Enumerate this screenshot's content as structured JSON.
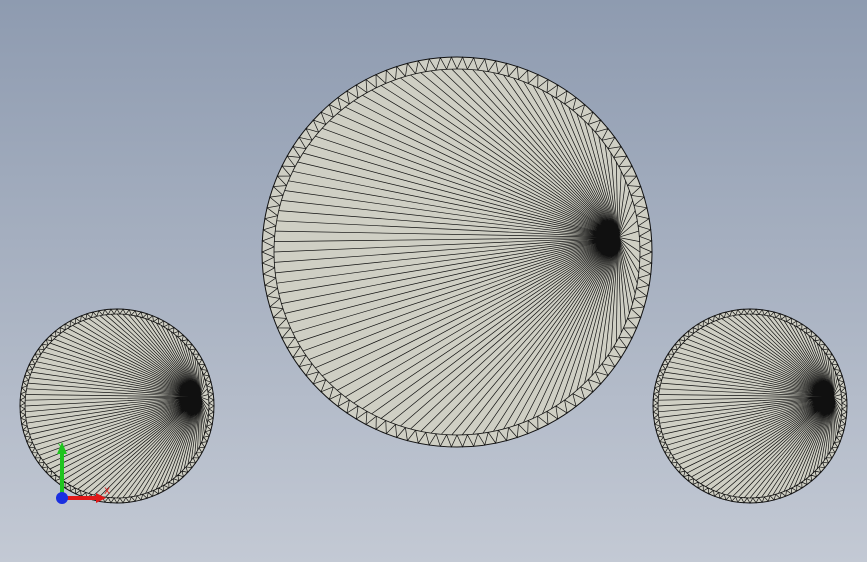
{
  "viewport": {
    "background_top": "#8e9bb0",
    "background_bottom": "#c3c9d4"
  },
  "model": {
    "face_color": "#cfcfc4",
    "edge_color": "#101010",
    "parts": [
      {
        "name": "large-disk",
        "segments": 110
      },
      {
        "name": "left-disk",
        "segments": 100
      },
      {
        "name": "right-disk",
        "segments": 100
      }
    ]
  },
  "triad": {
    "x_label": "X",
    "y_label": "Y",
    "x_color": "#e01818",
    "y_color": "#1fc41f",
    "z_color": "#1a2fe0"
  }
}
